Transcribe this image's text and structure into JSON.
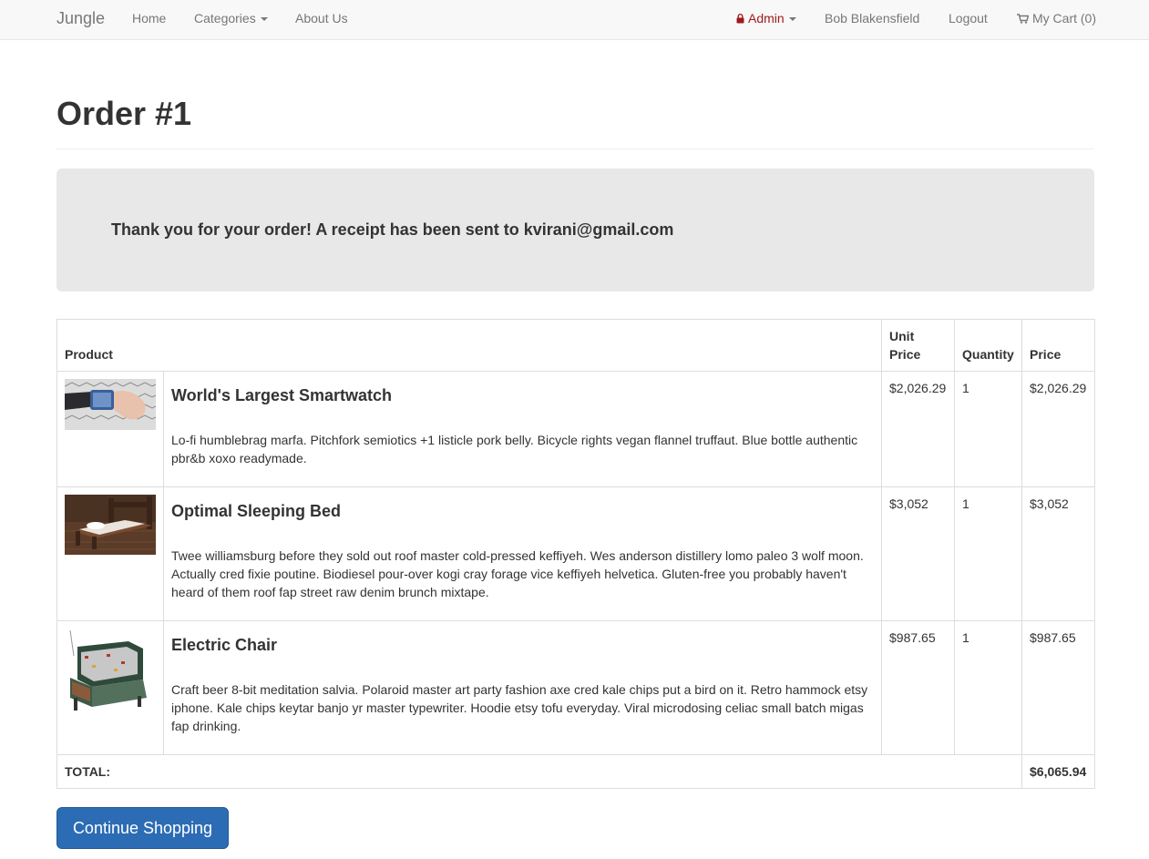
{
  "nav": {
    "brand": "Jungle",
    "home": "Home",
    "categories": "Categories",
    "about": "About Us",
    "admin": "Admin",
    "user": "Bob Blakensfield",
    "logout": "Logout",
    "cart": "My Cart (0)"
  },
  "page": {
    "title": "Order #1",
    "alert": "Thank you for your order! A receipt has been sent to kvirani@gmail.com"
  },
  "table": {
    "headers": {
      "product": "Product",
      "unit_price": "Unit Price",
      "quantity": "Quantity",
      "price": "Price"
    },
    "rows": [
      {
        "name": "World's Largest Smartwatch",
        "description": "Lo-fi humblebrag marfa. Pitchfork semiotics +1 listicle pork belly. Bicycle rights vegan flannel truffaut. Blue bottle authentic pbr&b xoxo readymade.",
        "unit_price": "$2,026.29",
        "quantity": "1",
        "price": "$2,026.29"
      },
      {
        "name": "Optimal Sleeping Bed",
        "description": "Twee williamsburg before they sold out roof master cold-pressed keffiyeh. Wes anderson distillery lomo paleo 3 wolf moon. Actually cred fixie poutine. Biodiesel pour-over kogi cray forage vice keffiyeh helvetica. Gluten-free you probably haven't heard of them roof fap street raw denim brunch mixtape.",
        "unit_price": "$3,052",
        "quantity": "1",
        "price": "$3,052"
      },
      {
        "name": "Electric Chair",
        "description": "Craft beer 8-bit meditation salvia. Polaroid master art party fashion axe cred kale chips put a bird on it. Retro hammock etsy iphone. Kale chips keytar banjo yr master typewriter. Hoodie etsy tofu everyday. Viral microdosing celiac small batch migas fap drinking.",
        "unit_price": "$987.65",
        "quantity": "1",
        "price": "$987.65"
      }
    ],
    "total_label": "TOTAL:",
    "total_value": "$6,065.94"
  },
  "button": {
    "continue": "Continue Shopping"
  },
  "colors": {
    "primary": "#2c6cb4",
    "admin": "#a01a1a",
    "alert_bg": "#e8e8e8"
  }
}
